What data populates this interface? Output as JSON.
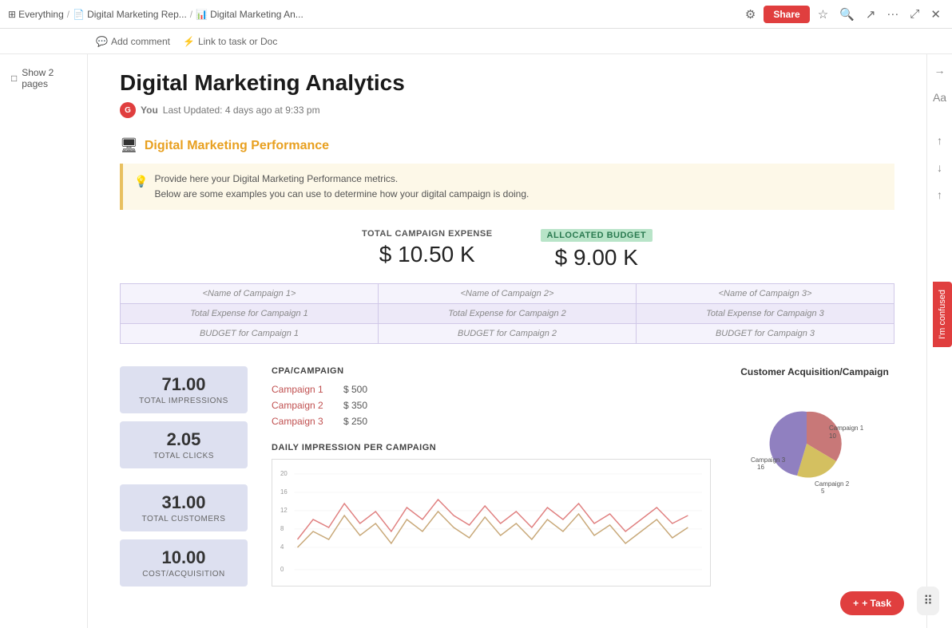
{
  "topbar": {
    "breadcrumb": [
      {
        "label": "Everything",
        "icon": "grid"
      },
      {
        "label": "Digital Marketing Rep...",
        "icon": "doc"
      },
      {
        "label": "Digital Marketing An...",
        "icon": "chart"
      }
    ],
    "share_label": "Share",
    "icons": [
      "settings",
      "star",
      "search",
      "export",
      "more",
      "expand",
      "close"
    ]
  },
  "subbar": {
    "add_comment": "Add comment",
    "link_task": "Link to task or Doc"
  },
  "sidebar": {
    "show_pages": "Show 2 pages"
  },
  "page": {
    "title": "Digital Marketing Analytics",
    "author": "You",
    "last_updated": "Last Updated: 4 days ago at 9:33 pm"
  },
  "section": {
    "heading": "Digital Marketing Performance",
    "info_line1": "Provide here your Digital Marketing Performance metrics.",
    "info_line2": "Below are some examples you can use to determine how your digital campaign is doing."
  },
  "kpi": {
    "total_expense_label": "TOTAL CAMPAIGN EXPENSE",
    "total_expense_value": "$ 10.50 K",
    "allocated_budget_label": "ALLOCATED BUDGET",
    "allocated_budget_value": "$ 9.00 K"
  },
  "campaign_table": {
    "rows": [
      [
        "<Name of Campaign 1>",
        "<Name of Campaign 2>",
        "<Name of Campaign 3>"
      ],
      [
        "Total Expense for Campaign 1",
        "Total Expense for Campaign 2",
        "Total Expense for Campaign 3"
      ],
      [
        "BUDGET for Campaign 1",
        "BUDGET for Campaign 2",
        "BUDGET for Campaign 3"
      ]
    ]
  },
  "metrics": {
    "impressions_value": "71.00",
    "impressions_label": "TOTAL IMPRESSIONS",
    "clicks_value": "2.05",
    "clicks_label": "TOTAL CLICKS",
    "customers_value": "31.00",
    "customers_label": "TOTAL CUSTOMERS",
    "cost_acq_value": "10.00",
    "cost_acq_label": "COST/ACQUISITION"
  },
  "cpa": {
    "title": "CPA/CAMPAIGN",
    "campaigns": [
      {
        "name": "Campaign 1",
        "value": "$ 500"
      },
      {
        "name": "Campaign 2",
        "value": "$ 350"
      },
      {
        "name": "Campaign 3",
        "value": "$ 250"
      }
    ]
  },
  "pie_chart": {
    "title": "Customer Acquisition/Campaign",
    "segments": [
      {
        "label": "Campaign 1",
        "value": 10,
        "color": "#c87878"
      },
      {
        "label": "Campaign 2",
        "value": 5,
        "color": "#d4c060"
      },
      {
        "label": "Campaign 3",
        "value": 16,
        "color": "#9080c0"
      }
    ]
  },
  "line_chart": {
    "title": "DAILY IMPRESSION PER CAMPAIGN",
    "y_max": 20,
    "y_labels": [
      "20",
      "16",
      "12",
      "8",
      "4",
      "0"
    ]
  },
  "feedback_label": "I'm confused",
  "task_label": "+ Task"
}
